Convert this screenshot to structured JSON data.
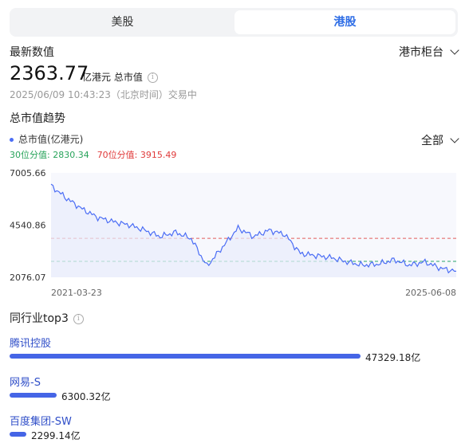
{
  "tabs": [
    {
      "label": "美股",
      "active": false
    },
    {
      "label": "港股",
      "active": true
    }
  ],
  "header": {
    "latest_label": "最新数值",
    "exchange": "港市柜台",
    "value": "2363.77",
    "unit": "亿港元 总市值",
    "timestamp": "2025/06/09 10:43:23（北京时间）交易中"
  },
  "trend": {
    "title": "总市值趋势",
    "legend": "总市值(亿港元)",
    "range": "全部",
    "p30_label": "30位分值: 2830.34",
    "p70_label": "70位分值: 3915.49"
  },
  "chart_data": {
    "type": "line",
    "series": [
      {
        "name": "总市值(亿港元)",
        "color": "#4c6ef5",
        "x": [
          "2021-03-23",
          "2021-05",
          "2021-07",
          "2021-09",
          "2021-11",
          "2022-01",
          "2022-03",
          "2022-05",
          "2022-07",
          "2022-09",
          "2022-11",
          "2023-01",
          "2023-03",
          "2023-05",
          "2023-07",
          "2023-09",
          "2023-11",
          "2024-01",
          "2024-03",
          "2024-05",
          "2024-07",
          "2024-09",
          "2024-11",
          "2025-01",
          "2025-03",
          "2025-05",
          "2025-06-08"
        ],
        "y": [
          6400,
          5800,
          5300,
          4900,
          4700,
          4550,
          4300,
          4000,
          4200,
          3900,
          2600,
          3500,
          4400,
          4000,
          4300,
          4100,
          3200,
          3100,
          3000,
          2800,
          2650,
          2700,
          2900,
          2650,
          2800,
          2500,
          2363.77
        ]
      }
    ],
    "yticks": [
      "7005.66",
      "4540.86",
      "2076.07"
    ],
    "xticks": [
      "2021-03-23",
      "2025-06-08"
    ],
    "ylim": [
      2076.07,
      7005.66
    ],
    "reference_lines": [
      {
        "value": 3915.49,
        "color": "#e25c5c",
        "label": "70位分值"
      },
      {
        "value": 2830.34,
        "color": "#2aa36b",
        "label": "30位分值"
      }
    ]
  },
  "peers": {
    "title": "同行业top3",
    "items": [
      {
        "name": "腾讯控股",
        "value_label": "47329.18亿",
        "value": 47329.18
      },
      {
        "name": "网易-S",
        "value_label": "6300.32亿",
        "value": 6300.32
      },
      {
        "name": "百度集团-SW",
        "value_label": "2299.14亿",
        "value": 2299.14
      }
    ]
  }
}
